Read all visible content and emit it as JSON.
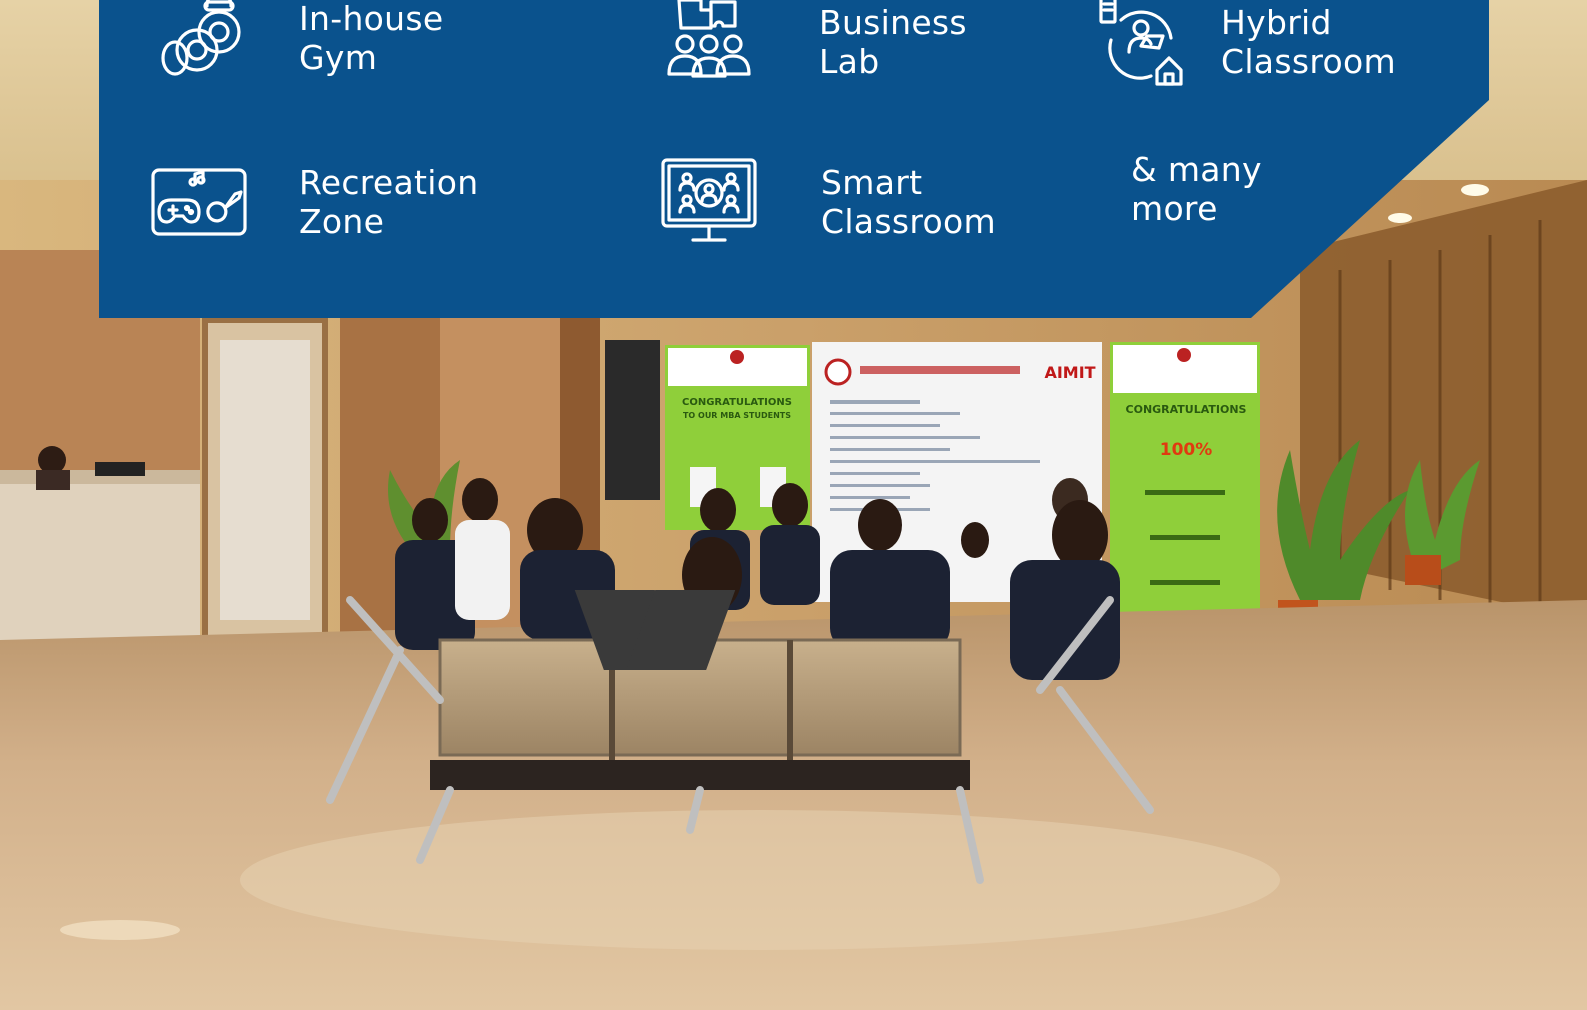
{
  "colors": {
    "panel_bg": "#0a528d",
    "text": "#ffffff",
    "floor": "#c9a57a",
    "banner_green": "#8fcf3a"
  },
  "features": [
    {
      "id": "gym",
      "icon": "kettlebell-icon",
      "line1": "In-house",
      "line2": "Gym"
    },
    {
      "id": "business-lab",
      "icon": "team-puzzle-icon",
      "line1": "Business",
      "line2": "Lab"
    },
    {
      "id": "hybrid-classroom",
      "icon": "remote-learning-icon",
      "line1": "Hybrid",
      "line2": "Classroom"
    },
    {
      "id": "recreation-zone",
      "icon": "gamepad-guitar-icon",
      "line1": "Recreation",
      "line2": "Zone"
    },
    {
      "id": "smart-classroom",
      "icon": "video-conference-monitor-icon",
      "line1": "Smart",
      "line2": "Classroom"
    },
    {
      "id": "many-more",
      "icon": "",
      "line1": "& many",
      "line2": "more"
    }
  ],
  "photo": {
    "banners": {
      "left_heading": "CONGRATULATIONS",
      "left_subheading": "TO OUR MBA STUDENTS",
      "center_brand": "AIMIT",
      "right_heading": "CONGRATULATIONS",
      "right_highlight": "100%"
    }
  }
}
